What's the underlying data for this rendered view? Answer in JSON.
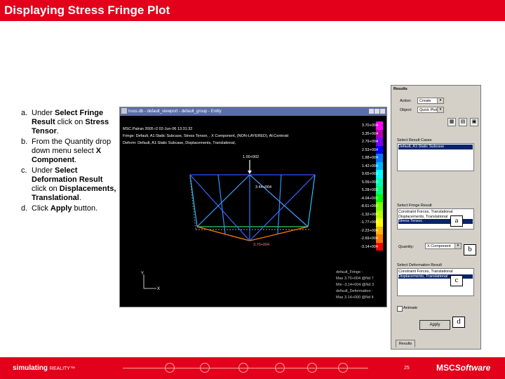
{
  "title": "Displaying Stress Fringe Plot",
  "steps": [
    {
      "letter": "a.",
      "parts": [
        {
          "t": "Under ",
          "b": false
        },
        {
          "t": "Select Fringe Result",
          "b": true
        },
        {
          "t": " click on ",
          "b": false
        },
        {
          "t": "Stress Tensor",
          "b": true
        },
        {
          "t": ".",
          "b": false
        }
      ]
    },
    {
      "letter": "b.",
      "parts": [
        {
          "t": "From the Quantity drop down menu select ",
          "b": false
        },
        {
          "t": "X Component",
          "b": true
        },
        {
          "t": ".",
          "b": false
        }
      ]
    },
    {
      "letter": "c.",
      "parts": [
        {
          "t": "Under ",
          "b": false
        },
        {
          "t": "Select Deformation Result",
          "b": true
        },
        {
          "t": " click on ",
          "b": false
        },
        {
          "t": "Displacements, Translational",
          "b": true
        },
        {
          "t": ".",
          "b": false
        }
      ]
    },
    {
      "letter": "d.",
      "parts": [
        {
          "t": "Click ",
          "b": false
        },
        {
          "t": "Apply",
          "b": true
        },
        {
          "t": " button.",
          "b": false
        }
      ]
    }
  ],
  "viewport": {
    "title": "truss.db - default_viewport - default_group - Entity",
    "header_lines": [
      "MSC.Patran 2005 r2 02-Jun-06 13:31:32",
      "Fringe: Default, A1:Static Subcase, Stress Tensor, , X Component, (NON-LAYERED), At:Centroid",
      "Deform: Default, A1:Static Subcase, Displacements, Translational,"
    ],
    "legend": {
      "colors": [
        "#ff00ff",
        "#b400b4",
        "#7800ff",
        "#0000ff",
        "#0078ff",
        "#00b4ff",
        "#00ffff",
        "#00ffb4",
        "#00ff78",
        "#00ff00",
        "#78ff00",
        "#b4ff00",
        "#ffff00",
        "#ffb400",
        "#ff7800",
        "#ff0000"
      ],
      "labels": [
        "3.70+004",
        "3.35+004",
        "2.79+004",
        "2.53+004",
        "1.88+004",
        "1.42+004",
        "9.65+003",
        "5.09+003",
        "5.28+002",
        "-4.04+003",
        "-8.61+003",
        "-1.32+004",
        "-1.77+004",
        "-2.23+004",
        "-2.69+004",
        "-3.14+004"
      ]
    },
    "annotations": [
      "1.00+002",
      "3.44+004",
      "3.70+004"
    ],
    "info_lines": [
      "default_Fringe :",
      "Max 3.70+004 @Nd 7",
      "Min -3.14+004 @Nd 3",
      "default_Deformation :",
      "Max 3.14+000 @Nd 4"
    ],
    "axis": {
      "y": "Y",
      "x": "X"
    }
  },
  "panel": {
    "title": "Results",
    "action_label": "Action:",
    "action_value": "Create",
    "object_label": "Object:",
    "object_value": "Quick Plot",
    "result_cases_label": "Select Result Cases",
    "result_cases": [
      "Default, A1:Static Subcase"
    ],
    "fringe_label": "Select Fringe Result",
    "fringe_items": [
      "Constraint Forces, Translational",
      "Displacements, Translational",
      "Stress Tensor,"
    ],
    "quantity_label": "Quantity:",
    "quantity_value": "X Component",
    "deform_label": "Select Deformation Result",
    "deform_items": [
      "Constraint Forces, Translational",
      "Displacements, Translational"
    ],
    "animate_label": "Animate",
    "apply_label": "Apply",
    "results_tab": "Results"
  },
  "callouts": [
    "a",
    "b",
    "c",
    "d"
  ],
  "footer": {
    "brand": "simulating",
    "brand2": "REALITY™",
    "page": "25",
    "logo": "MSC",
    "logo2": "Software"
  }
}
